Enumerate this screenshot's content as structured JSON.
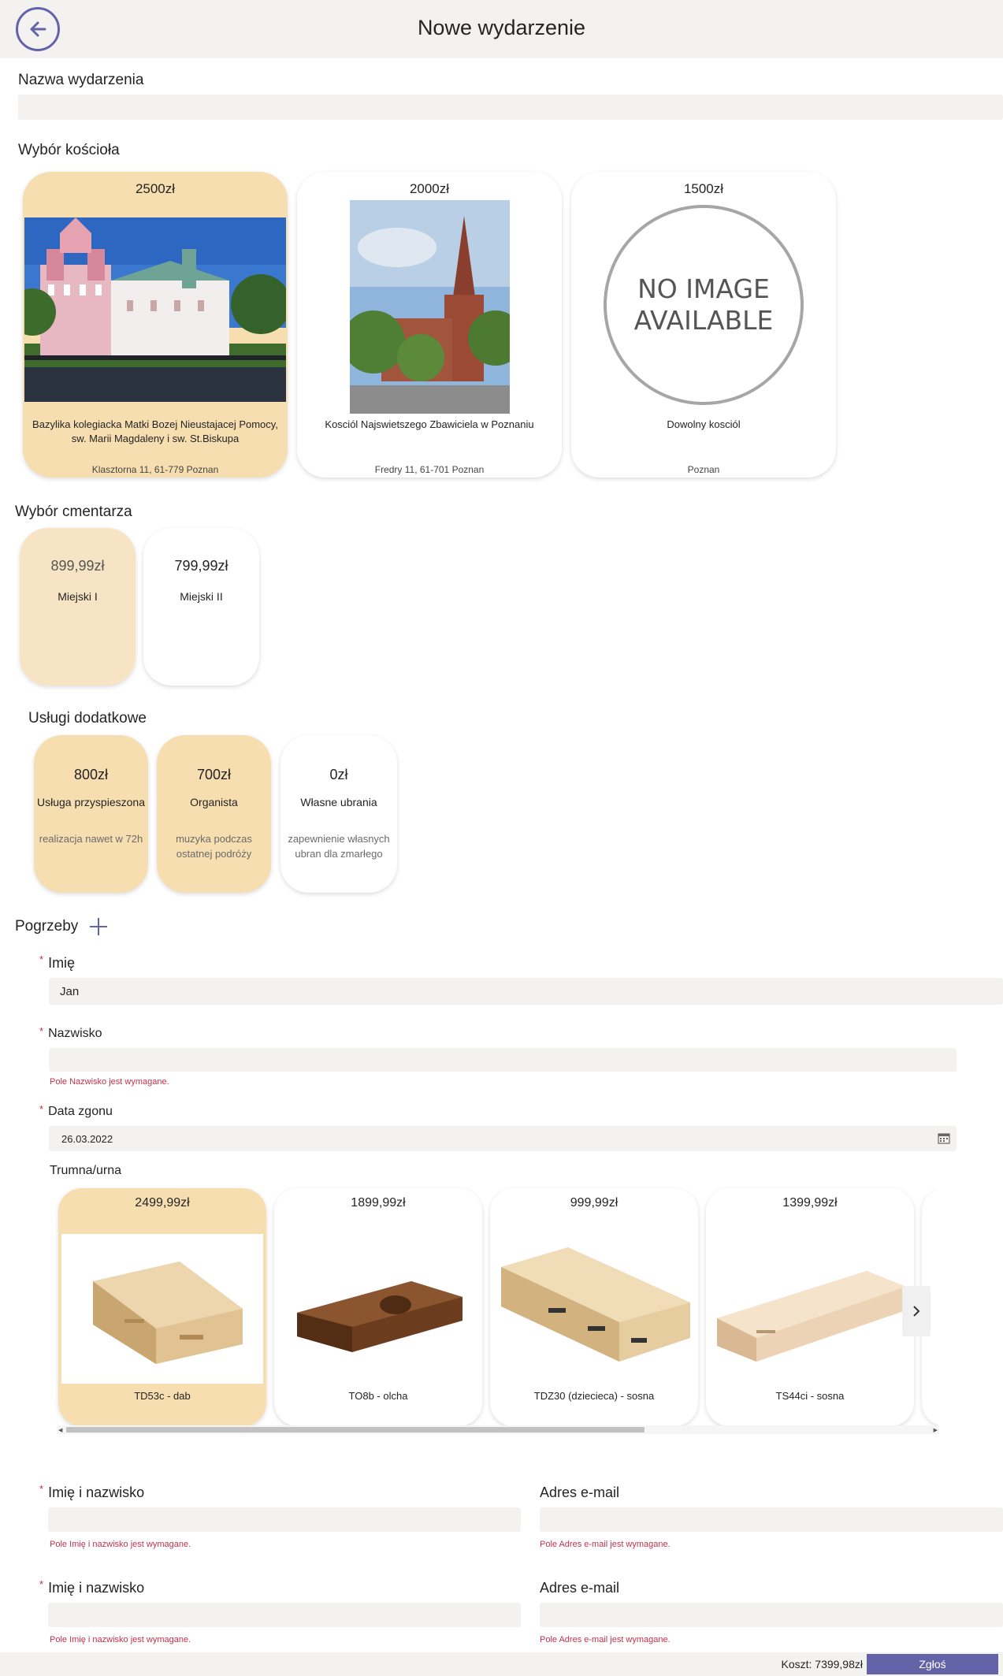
{
  "header": {
    "title": "Nowe wydarzenie",
    "back_icon": "arrow-left-icon"
  },
  "event_name": {
    "label": "Nazwa wydarzenia",
    "value": "",
    "placeholder": ""
  },
  "churches": {
    "label": "Wybór kościoła",
    "items": [
      {
        "price": "2500zł",
        "name": "Bazylika kolegiacka Matki Bozej Nieustajacej Pomocy, sw. Marii Magdaleny i sw. St.Biskupa",
        "address": "Klasztorna 11, 61-779 Poznan",
        "selected": true
      },
      {
        "price": "2000zł",
        "name": "Kosciól Najswietszego Zbawiciela w Poznaniu",
        "address": "Fredry 11, 61-701 Poznan",
        "selected": false
      },
      {
        "price": "1500zł",
        "name": "Dowolny kosciól",
        "address": "Poznan",
        "selected": false,
        "placeholder_line1": "NO IMAGE",
        "placeholder_line2": "AVAILABLE"
      }
    ]
  },
  "cemeteries": {
    "label": "Wybór cmentarza",
    "items": [
      {
        "price": "899,99zł",
        "name": "Miejski I",
        "selected": true
      },
      {
        "price": "799,99zł",
        "name": "Miejski II",
        "selected": false
      }
    ]
  },
  "services": {
    "label": "Usługi dodatkowe",
    "items": [
      {
        "price": "800zł",
        "name": "Usługa przyspieszona",
        "desc": "realizacja nawet w 72h",
        "selected": true
      },
      {
        "price": "700zł",
        "name": "Organista",
        "desc": "muzyka podczas ostatnej podróży",
        "selected": true
      },
      {
        "price": "0zł",
        "name": "Własne ubrania",
        "desc": "zapewnienie własnych ubran dla zmarłego",
        "selected": false
      }
    ]
  },
  "burials": {
    "label": "Pogrzeby",
    "add_icon": "plus-icon",
    "first_name": {
      "label": "Imię",
      "value": "Jan"
    },
    "last_name": {
      "label": "Nazwisko",
      "value": "",
      "error": "Pole Nazwisko jest wymagane."
    },
    "death_date": {
      "label": "Data zgonu",
      "value": "26.03.2022",
      "icon": "calendar-icon"
    },
    "coffin": {
      "label": "Trumna/urna",
      "items": [
        {
          "price": "2499,99zł",
          "name": "TD53c - dab",
          "selected": true
        },
        {
          "price": "1899,99zł",
          "name": "TO8b - olcha",
          "selected": false
        },
        {
          "price": "999,99zł",
          "name": "TDZ30 (dziecieca) - sosna",
          "selected": false
        },
        {
          "price": "1399,99zł",
          "name": "TS44ci - sosna",
          "selected": false
        }
      ],
      "next_icon": "chevron-right-icon",
      "scroll_fraction": 0.67
    }
  },
  "contacts": [
    {
      "name": {
        "label": "Imię i nazwisko",
        "value": "",
        "error": "Pole Imię i nazwisko jest wymagane."
      },
      "email": {
        "label": "Adres e-mail",
        "value": "",
        "error": "Pole Adres e-mail jest wymagane."
      }
    },
    {
      "name": {
        "label": "Imię i nazwisko",
        "value": "",
        "error": "Pole Imię i nazwisko jest wymagane."
      },
      "email": {
        "label": "Adres e-mail",
        "value": "",
        "error": "Pole Adres e-mail jest wymagane."
      }
    }
  ],
  "footer": {
    "cost": "Koszt: 7399,98zł",
    "submit_label": "Zgłoś"
  },
  "colors": {
    "accent": "#6264a7",
    "selected": "#f7deb0",
    "error": "#c4314b",
    "input_bg": "#f3f2f1"
  }
}
